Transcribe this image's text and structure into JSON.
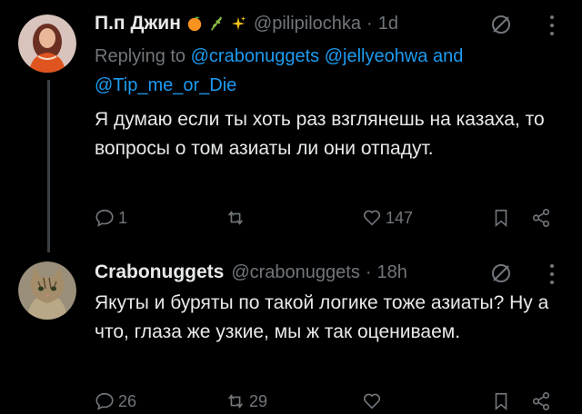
{
  "tweets": [
    {
      "author_name": "П.п Джин",
      "handle": "@pilipilochka",
      "dot": "·",
      "time": "1d",
      "replying_prefix": "Replying to",
      "mentions": [
        "@crabonuggets",
        "@jellyeohwa",
        "@Tip_me_or_Die"
      ],
      "mention_joiner": "and",
      "text": "Я думаю если ты хоть раз взглянешь на казаха, то вопросы о том азиаты ли они отпадут.",
      "reply_count": "1",
      "retweet_count": "",
      "like_count": "147"
    },
    {
      "author_name": "Crabonuggets",
      "handle": "@crabonuggets",
      "dot": "·",
      "time": "18h",
      "text": "Якуты и буряты по такой логике тоже азиаты? Ну а что, глаза же узкие, мы ж так оцениваем.",
      "reply_count": "26",
      "retweet_count": "29",
      "like_count": ""
    }
  ],
  "colors": {
    "background": "#000000",
    "text": "#e7e9ea",
    "muted": "#71767b",
    "link": "#1d9bf0",
    "thread_line": "#3a3f44"
  },
  "icons": [
    "reply-icon",
    "retweet-icon",
    "like-icon",
    "bookmark-icon",
    "share-icon",
    "muted-icon",
    "more-icon"
  ]
}
